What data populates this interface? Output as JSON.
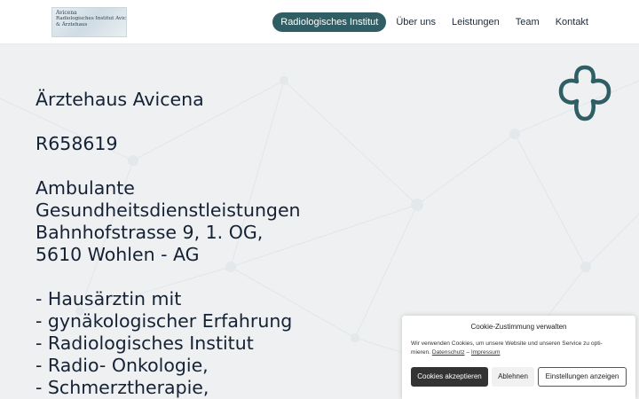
{
  "header": {
    "logo": {
      "lines": [
        "Avicena",
        "Radiologisches Institut Avicena",
        "& Ärztehaus"
      ]
    },
    "nav": [
      {
        "label": "Radiologisches Institut",
        "active": true
      },
      {
        "label": "Über uns",
        "active": false
      },
      {
        "label": "Leistungen",
        "active": false
      },
      {
        "label": "Team",
        "active": false
      },
      {
        "label": "Kontakt",
        "active": false
      }
    ],
    "active_color": "#2f5f64"
  },
  "main": {
    "title": "Ärztehaus Avicena",
    "code": "R658619",
    "address": [
      "Ambulante",
      "Gesundheitsdienstleistungen",
      "Bahnhofstrasse 9, 1. OG,",
      "5610 Wohlen - AG"
    ],
    "services": [
      "- Hausärztin mit",
      "- gynäkologischer Erfahrung",
      "- Radiologisches Institut",
      "- Radio- Onkologie,",
      "- Schmerztherapie,"
    ]
  },
  "decor": {
    "clover_icon": "clover-logo-icon",
    "clover_color": "#2f5f64"
  },
  "cookie_banner": {
    "title": "Cookie-Zustimmung verwalten",
    "text_line1": "Wir verwenden Cookies, um unsere Website und unseren Service zu opti-",
    "text_line2_prefix": "mieren.",
    "privacy_link": "Datenschutz",
    "separator": "–",
    "imprint_link": "Impressum",
    "accept_label": "Cookies akzeptieren",
    "deny_label": "Ablehnen",
    "preferences_label": "Einstellungen anzeigen"
  }
}
